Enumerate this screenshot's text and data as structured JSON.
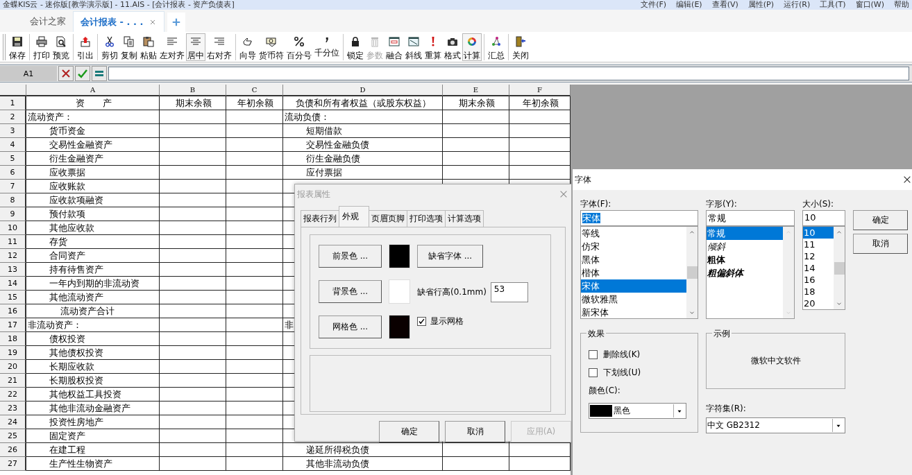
{
  "window": {
    "title": "金蝶KIS云 - 迷你版[教学演示版] - 11.AIS - [会计报表 - 资产负债表]",
    "menu": [
      "文件(F)",
      "编辑(E)",
      "查看(V)",
      "属性(P)",
      "运行(R)",
      "工具(T)",
      "窗口(W)",
      "帮助"
    ]
  },
  "tabs": [
    {
      "label": "会计之家",
      "selected": false
    },
    {
      "label": "会计报表 - . . .",
      "selected": true
    }
  ],
  "toolbar": [
    {
      "buttons": [
        {
          "label": "保存",
          "kind": "save",
          "pressed": false,
          "disabled": false
        }
      ]
    },
    {
      "buttons": [
        {
          "label": "打印",
          "kind": "print",
          "pressed": false,
          "disabled": false
        },
        {
          "label": "预览",
          "kind": "preview",
          "pressed": false,
          "disabled": false
        }
      ]
    },
    {
      "buttons": [
        {
          "label": "引出",
          "kind": "export",
          "pressed": false,
          "disabled": false
        }
      ]
    },
    {
      "buttons": [
        {
          "label": "剪切",
          "kind": "cut",
          "pressed": false,
          "disabled": false
        },
        {
          "label": "复制",
          "kind": "copy",
          "pressed": false,
          "disabled": false
        },
        {
          "label": "粘贴",
          "kind": "paste",
          "pressed": false,
          "disabled": false
        },
        {
          "label": "左对齐",
          "kind": "alignleft",
          "pressed": false,
          "disabled": false
        },
        {
          "label": "居中",
          "kind": "aligncenter",
          "pressed": true,
          "disabled": false
        },
        {
          "label": "右对齐",
          "kind": "alignright",
          "pressed": false,
          "disabled": false
        }
      ]
    },
    {
      "buttons": [
        {
          "label": "向导",
          "kind": "wizard",
          "pressed": false,
          "disabled": false
        },
        {
          "label": "货币符",
          "kind": "currency",
          "pressed": false,
          "disabled": false
        },
        {
          "label": "百分号",
          "kind": "percent",
          "pressed": false,
          "disabled": false
        },
        {
          "label": "千分位",
          "kind": "comma",
          "pressed": false,
          "disabled": false
        }
      ]
    },
    {
      "buttons": [
        {
          "label": "锁定",
          "kind": "lock",
          "pressed": false,
          "disabled": false
        },
        {
          "label": "参数",
          "kind": "trash",
          "pressed": false,
          "disabled": true
        },
        {
          "label": "融合",
          "kind": "merge",
          "pressed": false,
          "disabled": false
        },
        {
          "label": "斜线",
          "kind": "diagonal",
          "pressed": false,
          "disabled": false
        },
        {
          "label": "重算",
          "kind": "recalc",
          "pressed": false,
          "disabled": false
        },
        {
          "label": "格式",
          "kind": "camera",
          "pressed": false,
          "disabled": false
        },
        {
          "label": "计算",
          "kind": "calc",
          "pressed": true,
          "disabled": false
        }
      ]
    },
    {
      "buttons": [
        {
          "label": "汇总",
          "kind": "summary",
          "pressed": false,
          "disabled": false
        }
      ]
    },
    {
      "buttons": [
        {
          "label": "关闭",
          "kind": "exit",
          "pressed": false,
          "disabled": false
        }
      ]
    }
  ],
  "formula_bar": {
    "cell": "A1"
  },
  "sheet": {
    "columns": [
      "A",
      "B",
      "C",
      "D",
      "E",
      "F"
    ],
    "rows": [
      {
        "number": "1",
        "asset": {
          "text": "资　　产",
          "kind": "heading"
        },
        "asset_end": "期末余额",
        "asset_start": "年初余额",
        "liability": {
          "text": "负债和所有者权益（或股东权益）",
          "kind": "heading"
        },
        "liability_end": "期末余额",
        "liability_start": "年初余额"
      },
      {
        "number": "2",
        "asset": {
          "text": "流动资产：",
          "kind": "section"
        },
        "liability": {
          "text": "流动负债：",
          "kind": "section"
        }
      },
      {
        "number": "3",
        "asset": {
          "text": "货币资金",
          "kind": "item"
        },
        "liability": {
          "text": "短期借款",
          "kind": "item"
        }
      },
      {
        "number": "4",
        "asset": {
          "text": "交易性金融资产",
          "kind": "item"
        },
        "liability": {
          "text": "交易性金融负债",
          "kind": "item"
        }
      },
      {
        "number": "5",
        "asset": {
          "text": "衍生金融资产",
          "kind": "item"
        },
        "liability": {
          "text": "衍生金融负债",
          "kind": "item"
        }
      },
      {
        "number": "6",
        "asset": {
          "text": "应收票据",
          "kind": "item"
        },
        "liability": {
          "text": "应付票据",
          "kind": "item"
        }
      },
      {
        "number": "7",
        "asset": {
          "text": "应收账款",
          "kind": "item"
        }
      },
      {
        "number": "8",
        "asset": {
          "text": "应收款项融资",
          "kind": "item"
        }
      },
      {
        "number": "9",
        "asset": {
          "text": "预付款项",
          "kind": "item"
        }
      },
      {
        "number": "10",
        "asset": {
          "text": "其他应收款",
          "kind": "item"
        }
      },
      {
        "number": "11",
        "asset": {
          "text": "存货",
          "kind": "item"
        }
      },
      {
        "number": "12",
        "asset": {
          "text": "合同资产",
          "kind": "item"
        }
      },
      {
        "number": "13",
        "asset": {
          "text": "持有待售资产",
          "kind": "item"
        }
      },
      {
        "number": "14",
        "asset": {
          "text": "一年内到期的非流动资",
          "kind": "item"
        }
      },
      {
        "number": "15",
        "asset": {
          "text": "其他流动资产",
          "kind": "item"
        }
      },
      {
        "number": "16",
        "asset": {
          "text": "流动资产合计",
          "kind": "total"
        }
      },
      {
        "number": "17",
        "asset": {
          "text": "非流动资产：",
          "kind": "section"
        },
        "liability": {
          "text": "非",
          "kind": "section"
        }
      },
      {
        "number": "18",
        "asset": {
          "text": "债权投资",
          "kind": "item"
        }
      },
      {
        "number": "19",
        "asset": {
          "text": "其他债权投资",
          "kind": "item"
        }
      },
      {
        "number": "20",
        "asset": {
          "text": "长期应收款",
          "kind": "item"
        }
      },
      {
        "number": "21",
        "asset": {
          "text": "长期股权投资",
          "kind": "item"
        }
      },
      {
        "number": "22",
        "asset": {
          "text": "其他权益工具投资",
          "kind": "item"
        }
      },
      {
        "number": "23",
        "asset": {
          "text": "其他非流动金融资产",
          "kind": "item"
        }
      },
      {
        "number": "24",
        "asset": {
          "text": "投资性房地产",
          "kind": "item"
        }
      },
      {
        "number": "25",
        "asset": {
          "text": "固定资产",
          "kind": "item"
        }
      },
      {
        "number": "26",
        "asset": {
          "text": "在建工程",
          "kind": "item"
        },
        "liability": {
          "text": "递延所得税负债",
          "kind": "item"
        }
      },
      {
        "number": "27",
        "asset": {
          "text": "生产性生物资产",
          "kind": "item"
        },
        "liability": {
          "text": "其他非流动负债",
          "kind": "item"
        }
      }
    ]
  },
  "report_dialog": {
    "title": "报表属性",
    "tabs": [
      {
        "label": "报表行列",
        "selected": false
      },
      {
        "label": "外观",
        "selected": true
      },
      {
        "label": "页眉页脚",
        "selected": false
      },
      {
        "label": "打印选项",
        "selected": false
      },
      {
        "label": "计算选项",
        "selected": false
      }
    ],
    "color_buttons": [
      {
        "label": "前景色 ...",
        "color": "#000000"
      },
      {
        "label": "背景色 ...",
        "color": "#ffffff"
      },
      {
        "label": "网格色 ...",
        "color": "#0a0000"
      }
    ],
    "font_button": "缺省字体 ...",
    "row_height": {
      "label": "缺省行高(0.1mm)",
      "value": "53"
    },
    "show_grid": {
      "label": "显示网格",
      "checked": true
    },
    "buttons": [
      {
        "label": "确定",
        "disabled": false
      },
      {
        "label": "取消",
        "disabled": false
      },
      {
        "label": "应用(A)",
        "disabled": true
      }
    ]
  },
  "font_dialog": {
    "title": "字体",
    "font": {
      "label": "字体(F):",
      "value": "宋体",
      "options": [
        {
          "label": "等线",
          "selected": false
        },
        {
          "label": "仿宋",
          "selected": false
        },
        {
          "label": "黑体",
          "selected": false
        },
        {
          "label": "楷体",
          "selected": false
        },
        {
          "label": "宋体",
          "selected": true
        },
        {
          "label": "微软雅黑",
          "selected": false
        },
        {
          "label": "新宋体",
          "selected": false
        }
      ]
    },
    "style": {
      "label": "字形(Y):",
      "value": "常规",
      "options": [
        {
          "label": "常规",
          "kind": "regular",
          "selected": true
        },
        {
          "label": "倾斜",
          "kind": "italic",
          "selected": false
        },
        {
          "label": "粗体",
          "kind": "bold",
          "selected": false
        },
        {
          "label": "粗偏斜体",
          "kind": "bolditalic",
          "selected": false
        }
      ]
    },
    "size": {
      "label": "大小(S):",
      "value": "10",
      "options": [
        {
          "label": "10",
          "selected": true
        },
        {
          "label": "11",
          "selected": false
        },
        {
          "label": "12",
          "selected": false
        },
        {
          "label": "14",
          "selected": false
        },
        {
          "label": "16",
          "selected": false
        },
        {
          "label": "18",
          "selected": false
        },
        {
          "label": "20",
          "selected": false
        }
      ]
    },
    "buttons": [
      "确定",
      "取消"
    ],
    "effects": {
      "title": "效果",
      "checkboxes": [
        {
          "label": "删除线(K)",
          "checked": false
        },
        {
          "label": "下划线(U)",
          "checked": false
        }
      ],
      "color_label": "颜色(C):",
      "color_value": "黑色",
      "color": "#000000"
    },
    "sample": {
      "title": "示例",
      "text": "微软中文软件"
    },
    "charset": {
      "label": "字符集(R):",
      "value": "中文 GB2312"
    }
  }
}
